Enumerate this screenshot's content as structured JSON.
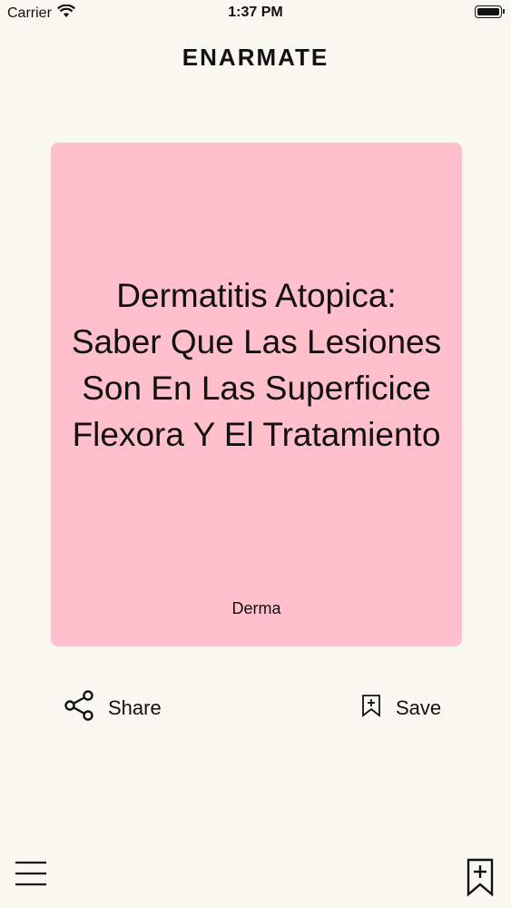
{
  "status_bar": {
    "carrier": "Carrier",
    "time": "1:37 PM"
  },
  "app": {
    "title": "ENARMATE"
  },
  "card": {
    "title": "Dermatitis Atopica: Saber Que Las Lesiones Son En Las Superficice Flexora Y El Tratamiento",
    "category": "Derma",
    "background_color": "#ffc0cb"
  },
  "actions": {
    "share_label": "Share",
    "share_icon": "share-icon",
    "save_label": "Save",
    "save_icon": "bookmark-add-icon"
  },
  "tab_bar": {
    "menu_icon": "hamburger-menu-icon",
    "bookmarks_icon": "bookmark-add-icon"
  },
  "colors": {
    "background": "#f9f8f0",
    "text": "#111111"
  }
}
